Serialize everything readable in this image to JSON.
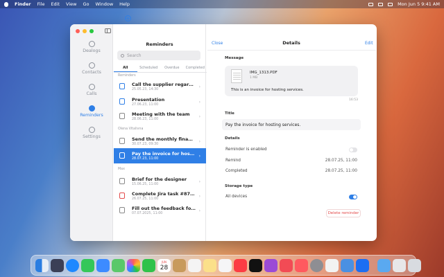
{
  "menubar": {
    "app": "Finder",
    "items": [
      "File",
      "Edit",
      "View",
      "Go",
      "Window",
      "Help"
    ],
    "clock": "Mon Jun 5  9:41 AM"
  },
  "sidebar": {
    "items": [
      {
        "label": "Dealogs",
        "icon": "chat-icon"
      },
      {
        "label": "Contacts",
        "icon": "contacts-icon"
      },
      {
        "label": "Calls",
        "icon": "phone-icon"
      },
      {
        "label": "Reminders",
        "icon": "alarm-icon",
        "active": true
      },
      {
        "label": "Settings",
        "icon": "gear-icon"
      }
    ]
  },
  "list": {
    "title": "Reminders",
    "search_placeholder": "Search",
    "tabs": [
      "All",
      "Scheduled",
      "Overdue",
      "Completed"
    ],
    "sections": [
      {
        "label": "Reminders"
      },
      {
        "label": "Olena Vitalivna"
      },
      {
        "label": "Max"
      }
    ],
    "items": [
      {
        "title": "Call the supplier regarding t...",
        "date": "25.05.23, 14:30"
      },
      {
        "title": "Presentation",
        "date": "27.06.23, 11:00"
      },
      {
        "title": "Meeting with the team",
        "date": "28.06.23, 11:00"
      },
      {
        "title": "Send the monthly financial r...",
        "date": "30.07.23, 09:30"
      },
      {
        "title": "Pay the invoice for hosting s...",
        "date": "28.07.23, 11:00",
        "selected": true
      },
      {
        "title": "Brief for the designer",
        "date": "15.06.25, 11:00"
      },
      {
        "title": "Complete Jira task #87654.",
        "date": "26.07.25, 11:00"
      },
      {
        "title": "Fill out the feedback form af...",
        "date": "07.07.2025, 11:00"
      }
    ]
  },
  "detail": {
    "close_label": "Close",
    "title": "Details",
    "edit_label": "Edit",
    "message_label": "Message",
    "file_name": "IMG_1313.PDF",
    "file_size": "1 MB",
    "message_text": "This is an invoice for hosting services.",
    "message_time": "16:53",
    "title_label": "Title",
    "title_value": "Pay the invoice for hosting services.",
    "details_label": "Details",
    "reminder_enabled_label": "Reminder is enabled",
    "remind_label": "Remind",
    "remind_value": "28.07.25, 11:00",
    "completed_label": "Completed",
    "completed_value": "28.07.25, 11:00",
    "storage_label": "Storage type",
    "all_devices_label": "All devices",
    "delete_label": "Delete reminder"
  },
  "dock": {
    "calendar_month": "JUN",
    "calendar_day": "28"
  },
  "colors": {
    "accent": "#2f7fe6",
    "danger": "#e34a4a"
  }
}
